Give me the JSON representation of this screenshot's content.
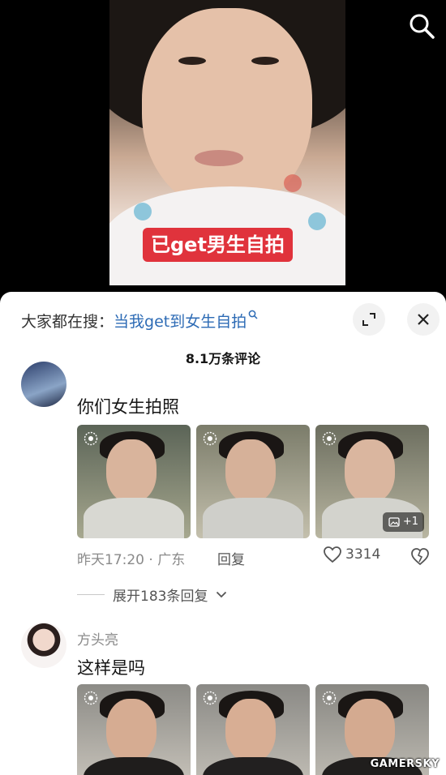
{
  "video": {
    "caption": "已get男生自拍",
    "search_icon": "search-icon"
  },
  "panel": {
    "search_prefix": "大家都在搜：",
    "search_query": "当我get到女生自拍",
    "comment_count": "8.1万条评论",
    "buttons": [
      "fullscreen-icon",
      "close-icon"
    ]
  },
  "comments": [
    {
      "text": "你们女生拍照",
      "thumbnails": [
        "live-photo-1",
        "live-photo-2",
        "live-photo-3"
      ],
      "more_badge": "+1",
      "time_location": "昨天17:20 · 广东",
      "reply_label": "回复",
      "likes": "3314",
      "expand_label": "展开183条回复"
    },
    {
      "username": "方头亮",
      "text": "这样是吗",
      "thumbnails": [
        "live-photo-4",
        "live-photo-5",
        "live-photo-6"
      ]
    }
  ],
  "watermark": "GAMERSKY",
  "colors": {
    "caption_bg": "#e0333c",
    "link": "#2d6bb5",
    "text": "#161616",
    "muted": "#8a8a8a"
  }
}
